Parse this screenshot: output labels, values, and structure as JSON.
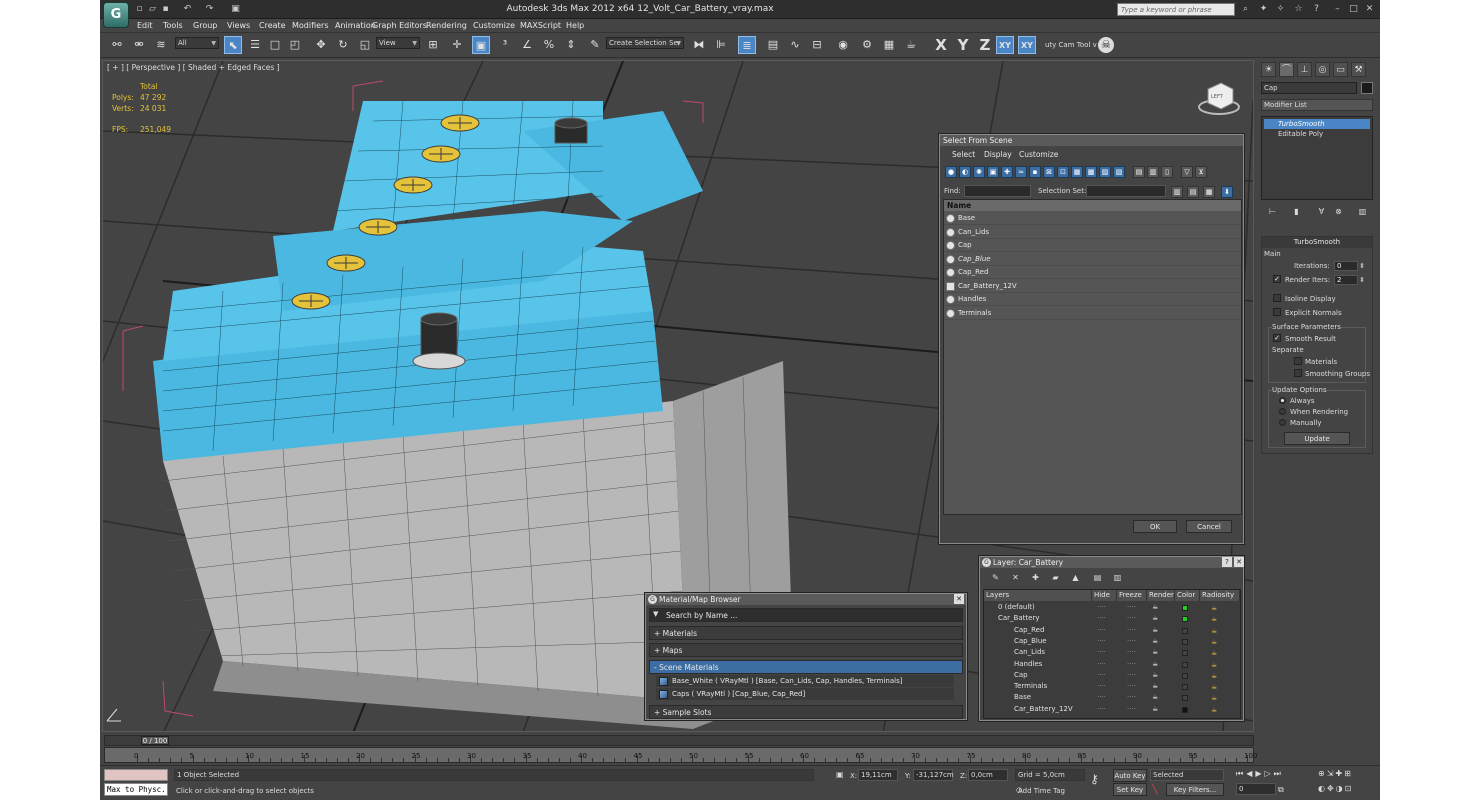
{
  "window": {
    "title": "Autodesk 3ds Max  2012 x64     12_Volt_Car_Battery_vray.max",
    "search_placeholder": "Type a keyword or phrase"
  },
  "menu": [
    "Edit",
    "Tools",
    "Group",
    "Views",
    "Create",
    "Modifiers",
    "Animation",
    "Graph Editors",
    "Rendering",
    "Customize",
    "MAXScript",
    "Help"
  ],
  "toolbar": {
    "filter": "All",
    "ref_coord": "View",
    "selection_set": "Create Selection Se",
    "axis_x": "X",
    "axis_y": "Y",
    "axis_z": "Z",
    "axis_xy": "XY",
    "axis_xy2": "XY",
    "plugin_label": "uty Cam Tool v"
  },
  "viewport": {
    "label": "[ + ] [ Perspective ] [ Shaded + Edged Faces ]",
    "stats": {
      "total_label": "Total",
      "polys_label": "Polys:",
      "polys": "47 292",
      "verts_label": "Verts:",
      "verts": "24 031",
      "fps_label": "FPS:",
      "fps": "251,049"
    },
    "viewcube_label": "LEFT"
  },
  "command_panel": {
    "object_name": "Cap",
    "modifier_list": "Modifier List",
    "stack": [
      "TurboSmooth",
      "Editable Poly"
    ],
    "turbosmooth": {
      "title": "TurboSmooth",
      "main": "Main",
      "iterations_label": "Iterations:",
      "iterations": "0",
      "render_iters_label": "Render Iters:",
      "render_iters": "2",
      "isoline": "Isoline Display",
      "explicit_normals": "Explicit Normals",
      "surface_params": "Surface Parameters",
      "smooth_result": "Smooth Result",
      "separate": "Separate",
      "materials": "Materials",
      "smoothing_groups": "Smoothing Groups",
      "update_options": "Update Options",
      "always": "Always",
      "when_rendering": "When Rendering",
      "manually": "Manually",
      "update_button": "Update"
    }
  },
  "select_from_scene": {
    "title": "Select From Scene",
    "menu": [
      "Select",
      "Display",
      "Customize"
    ],
    "find_label": "Find:",
    "selection_set_label": "Selection Set:",
    "column_name": "Name",
    "items": [
      "Base",
      "Can_Lids",
      "Cap",
      "Cap_Blue",
      "Cap_Red",
      "Car_Battery_12V",
      "Handles",
      "Terminals"
    ],
    "ok": "OK",
    "cancel": "Cancel"
  },
  "layer_dialog": {
    "title": "Layer: Car_Battery",
    "columns": [
      "Layers",
      "Hide",
      "Freeze",
      "Render",
      "Color",
      "Radiosity"
    ],
    "rows": [
      {
        "name": "0 (default)",
        "color": "#22cc22",
        "indent": 0
      },
      {
        "name": "Car_Battery",
        "color": "#22cc22",
        "indent": 0
      },
      {
        "name": "Cap_Red",
        "color": "#444444",
        "indent": 1
      },
      {
        "name": "Cap_Blue",
        "color": "#444444",
        "indent": 1
      },
      {
        "name": "Can_Lids",
        "color": "#444444",
        "indent": 1
      },
      {
        "name": "Handles",
        "color": "#444444",
        "indent": 1
      },
      {
        "name": "Cap",
        "color": "#444444",
        "indent": 1
      },
      {
        "name": "Terminals",
        "color": "#444444",
        "indent": 1
      },
      {
        "name": "Base",
        "color": "#444444",
        "indent": 1
      },
      {
        "name": "Car_Battery_12V",
        "color": "#111111",
        "indent": 1
      }
    ]
  },
  "material_browser": {
    "title": "Material/Map Browser",
    "search": "Search by Name ...",
    "groups": [
      "+ Materials",
      "+ Maps",
      "- Scene Materials",
      "+ Sample Slots"
    ],
    "scene_materials": [
      "Base_White  ( VRayMtl )  [Base, Can_Lids, Cap, Handles, Terminals]",
      "Caps  ( VRayMtl )  [Cap_Blue, Cap_Red]"
    ]
  },
  "timeline": {
    "frame": "0 / 100",
    "ticks": [
      "0",
      "5",
      "10",
      "15",
      "20",
      "25",
      "30",
      "35",
      "40",
      "45",
      "50",
      "55",
      "60",
      "65",
      "70",
      "75",
      "80",
      "85",
      "90",
      "95",
      "100"
    ]
  },
  "status": {
    "maxscript": "Max to Physc.",
    "selected": "1 Object Selected",
    "prompt": "Click or click-and-drag to select objects",
    "x_label": "X:",
    "x": "19,11cm",
    "y_label": "Y:",
    "y": "-31,127cm",
    "z_label": "Z:",
    "z": "0,0cm",
    "grid": "Grid = 5,0cm",
    "add_time_tag": "Add Time Tag",
    "auto_key": "Auto Key",
    "set_key": "Set Key",
    "key_mode": "Selected",
    "key_filters": "Key Filters...",
    "current_frame": "0"
  }
}
